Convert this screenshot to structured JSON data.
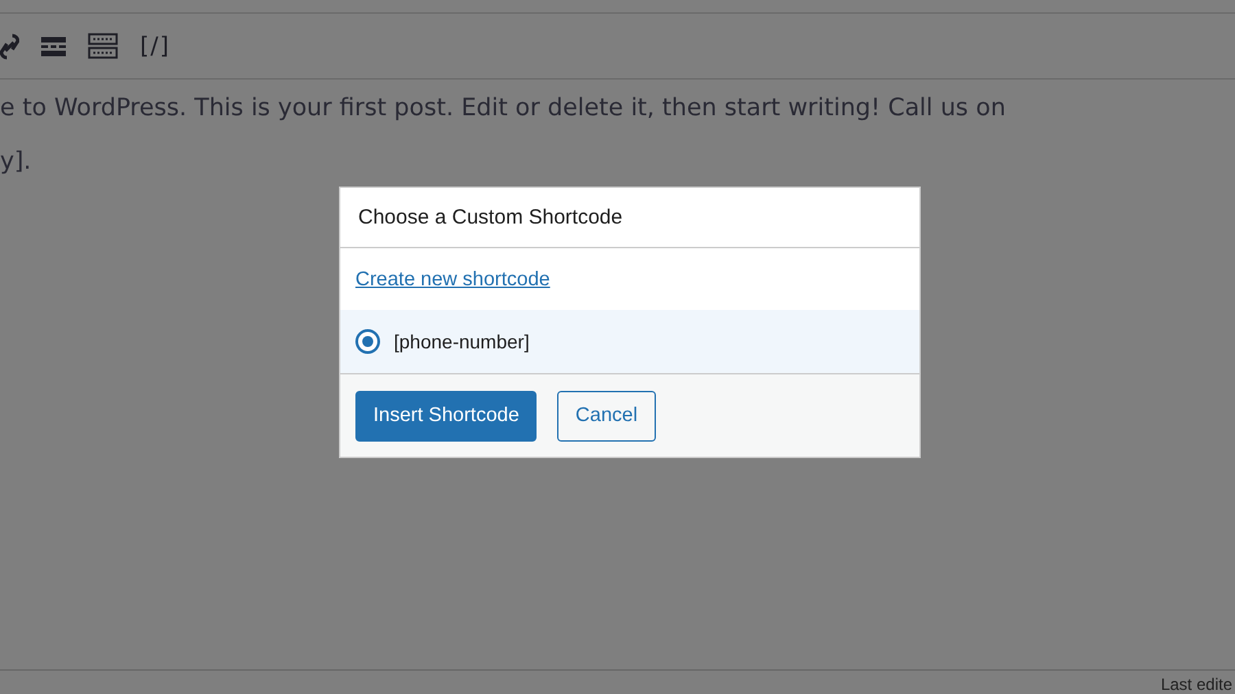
{
  "toolbar": {
    "shortcode_label": "[/]"
  },
  "editor": {
    "lines": [
      "e to WordPress. This is your first post. Edit or delete it, then start writing! Call us on",
      "y]."
    ]
  },
  "status_bar": {
    "text": "Last edite"
  },
  "dialog": {
    "title": "Choose a Custom Shortcode",
    "create_link": "Create new shortcode",
    "options": [
      {
        "label": "[phone-number]",
        "selected": true
      }
    ],
    "buttons": [
      {
        "label": "Insert Shortcode",
        "kind": "primary"
      },
      {
        "label": "Cancel",
        "kind": "secondary"
      }
    ]
  }
}
